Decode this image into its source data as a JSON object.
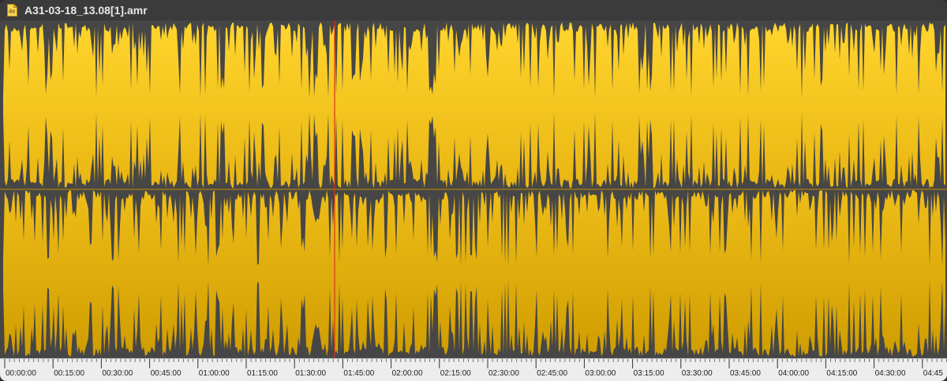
{
  "window": {
    "file_title": "A31-03-18_13.08[1].amr",
    "file_icon": "audio-file-icon"
  },
  "waveform": {
    "channels": 2,
    "color": "#f2c21a",
    "background": "#464646",
    "playhead_color": "#d9341c",
    "playhead_time": "01:38"
  },
  "ruler": {
    "labels": [
      "00:00:00",
      "00:15:00",
      "00:30:00",
      "00:45:00",
      "01:00:00",
      "01:15:00",
      "01:30:00",
      "01:45:00",
      "02:00:00",
      "02:15:00",
      "02:30:00",
      "02:45:00",
      "03:00:00",
      "03:15:00",
      "03:30:00",
      "03:45:00",
      "04:00:00",
      "04:15:00",
      "04:30:00",
      "04:45"
    ]
  }
}
